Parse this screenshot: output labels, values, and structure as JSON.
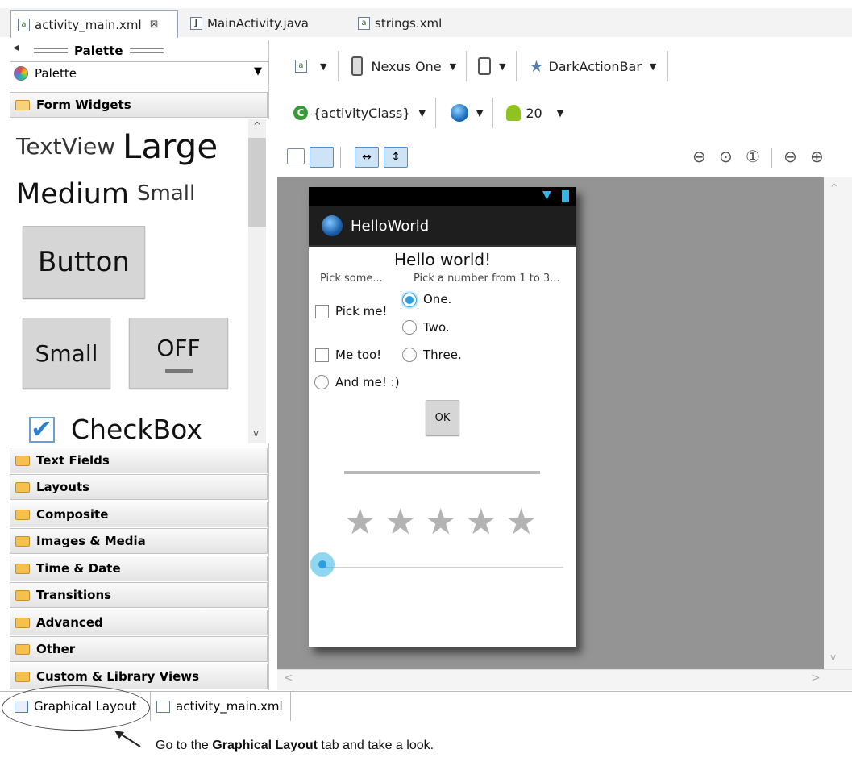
{
  "editor_tabs": [
    {
      "label": "activity_main.xml",
      "active": true,
      "icon": "xml-file-icon"
    },
    {
      "label": "MainActivity.java",
      "active": false,
      "icon": "java-file-icon"
    },
    {
      "label": "strings.xml",
      "active": false,
      "icon": "xml-file-icon"
    }
  ],
  "palette": {
    "header": "Palette",
    "select_value": "Palette",
    "open_category": "Form Widgets",
    "widgets": {
      "textview": "TextView",
      "large": "Large",
      "medium": "Medium",
      "small": "Small",
      "button": "Button",
      "small_button": "Small",
      "toggle": "OFF",
      "checkbox": "CheckBox"
    },
    "categories": [
      "Text Fields",
      "Layouts",
      "Composite",
      "Images & Media",
      "Time & Date",
      "Transitions",
      "Advanced",
      "Other",
      "Custom & Library Views"
    ]
  },
  "toolbar": {
    "device": "Nexus One",
    "theme": "DarkActionBar",
    "activity": "{activityClass}",
    "api_level": "20"
  },
  "device_screen": {
    "app_title": "HelloWorld",
    "heading": "Hello world!",
    "col1_label": "Pick some...",
    "col2_label": "Pick a number from 1 to 3...",
    "checkbox1": "Pick me!",
    "checkbox2": "Me too!",
    "radio_and_me": "And me! :)",
    "radio_one": "One.",
    "radio_two": "Two.",
    "radio_three": "Three.",
    "ok_button": "OK",
    "rating_stars": 5,
    "rating_filled": 0
  },
  "bottom_tabs": [
    {
      "label": "Graphical Layout",
      "active": true
    },
    {
      "label": "activity_main.xml",
      "active": false
    }
  ],
  "caption": {
    "prefix": "Go to the ",
    "bold": "Graphical Layout",
    "suffix": " tab and take a look."
  },
  "colors": {
    "accent": "#2a9ee0",
    "canvas_bg": "#949494",
    "actionbar_bg": "#1e1e1e"
  }
}
